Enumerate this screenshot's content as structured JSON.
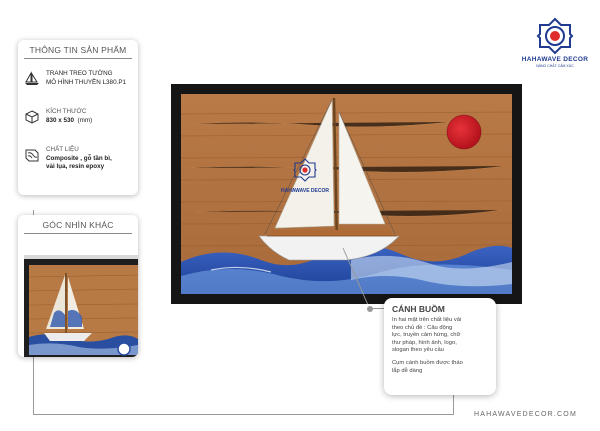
{
  "brand": {
    "name": "HAHAWAVE DECOR",
    "tagline": "NÂNG CHẤT CẢM XÚC",
    "sail_logo_text": "HAHAWAVE DECOR",
    "colors": {
      "primary": "#1f3a8f",
      "accent": "#e02b2b"
    }
  },
  "product_info": {
    "title": "THÔNG TIN SẢN PHẨM",
    "name_line1": "TRANH TREO TƯỜNG",
    "name_line2": "MÔ HÌNH THUYỀN L380.P1",
    "size_label": "KÍCH THƯỚC",
    "size_value": "830 x 530",
    "size_unit": "(mm)",
    "material_label": "CHẤT LIỆU",
    "material_line1": "Composite , gỗ tần bì,",
    "material_line2": "vải lụa, resin epoxy",
    "icons": [
      "boat-icon",
      "dimension-cube-icon",
      "material-layers-icon"
    ]
  },
  "other_angle": {
    "title": "GÓC NHÌN KHÁC"
  },
  "callout": {
    "title": "CÁNH BUỒM",
    "desc_lines": [
      "In hai mặt trên chất liệu vải",
      "theo chủ đề  : Câu động",
      "lực, truyền cảm hứng, chữ",
      "thư pháp, hình ảnh, logo,",
      "slogan theo yêu cầu"
    ],
    "note_lines": [
      "Cụm cánh buồm được tháo",
      "lắp dễ dàng"
    ]
  },
  "footer": {
    "url": "HAHAWAVEDECOR.COM"
  }
}
